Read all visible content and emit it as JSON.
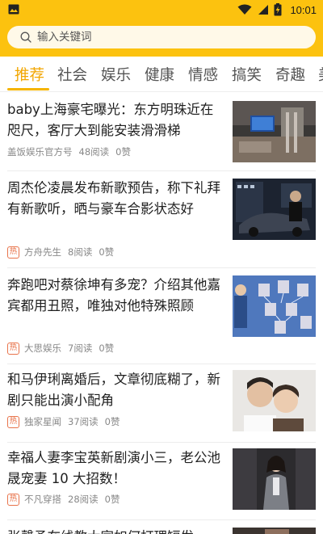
{
  "status_bar": {
    "time": "10:01",
    "icons": [
      "image-notification-icon",
      "wifi-icon",
      "signal-icon",
      "battery-charging-icon"
    ]
  },
  "search": {
    "placeholder": "输入关键词",
    "value": ""
  },
  "tabs": [
    {
      "label": "推荐",
      "active": true
    },
    {
      "label": "社会",
      "active": false
    },
    {
      "label": "娱乐",
      "active": false
    },
    {
      "label": "健康",
      "active": false
    },
    {
      "label": "情感",
      "active": false
    },
    {
      "label": "搞笑",
      "active": false
    },
    {
      "label": "奇趣",
      "active": false
    },
    {
      "label": "美",
      "active": false
    }
  ],
  "colors": {
    "header": "#FCC20F",
    "accent": "#F2A600",
    "hot_badge": "#E8734A"
  },
  "articles": [
    {
      "title": "baby上海豪宅曝光：东方明珠近在咫尺，客厅大到能安装滑滑梯",
      "hot": false,
      "hot_label": "",
      "source": "盖饭娱乐官方号",
      "reads": "48阅读",
      "likes": "0赞",
      "thumb": "living-room-photo"
    },
    {
      "title": "周杰伦凌晨发布新歌预告，称下礼拜有新歌听，晒与豪车合影状态好",
      "hot": true,
      "hot_label": "热",
      "source": "方舟先生",
      "reads": "8阅读",
      "likes": "0赞",
      "thumb": "car-night-photo"
    },
    {
      "title": "奔跑吧对蔡徐坤有多宠？介绍其他嘉宾都用丑照，唯独对他特殊照顾",
      "hot": true,
      "hot_label": "热",
      "source": "大思娱乐",
      "reads": "7阅读",
      "likes": "0赞",
      "thumb": "tv-show-photo"
    },
    {
      "title": "和马伊琍离婚后，文章彻底糊了，新剧只能出演小配角",
      "hot": true,
      "hot_label": "热",
      "source": "独家星闻",
      "reads": "37阅读",
      "likes": "0赞",
      "thumb": "couple-photo"
    },
    {
      "title": "幸福人妻李宝英新剧演小三，老公池晟宠妻 10 大招数！",
      "hot": true,
      "hot_label": "热",
      "source": "不凡穿搭",
      "reads": "28阅读",
      "likes": "0赞",
      "thumb": "actress-photo"
    },
    {
      "title": "张馨予在线教大家如何打理短发",
      "hot": false,
      "hot_label": "",
      "source": "",
      "reads": "",
      "likes": "",
      "thumb": "partial-photo"
    }
  ]
}
